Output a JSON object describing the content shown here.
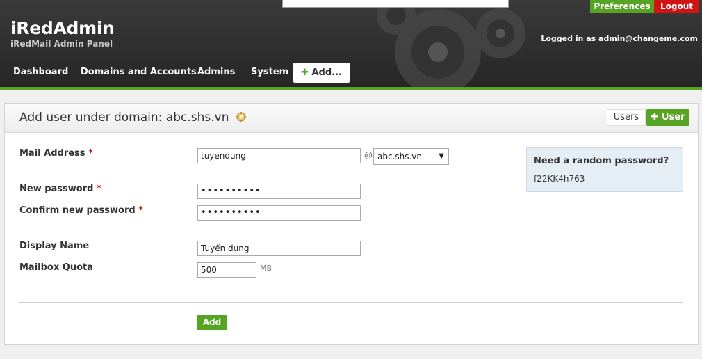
{
  "header": {
    "brand": "iRedAdmin",
    "tagline": "iRedMail Admin Panel",
    "preferences_label": "Preferences",
    "logout_label": "Logout",
    "logged_in_text": "Logged in as admin@changeme.com"
  },
  "nav": {
    "items": [
      "Dashboard",
      "Domains and Accounts",
      "Admins",
      "System"
    ],
    "add_label": "Add..."
  },
  "panel": {
    "title": "Add user under domain: abc.shs.vn",
    "tab_users": "Users",
    "tab_user": "User"
  },
  "form": {
    "mail_address_label": "Mail Address",
    "mail_address_value": "tuyendung",
    "at_sign": "@",
    "domain_selected": "abc.shs.vn",
    "new_password_label": "New password",
    "new_password_value": "••••••••••",
    "confirm_password_label": "Confirm new password",
    "confirm_password_value": "••••••••••",
    "display_name_label": "Display Name",
    "display_name_value": "Tuyển dụng",
    "quota_label": "Mailbox Quota",
    "quota_value": "500",
    "quota_unit": "MB",
    "required_mark": "*",
    "submit_label": "Add"
  },
  "random_password": {
    "title": "Need a random password?",
    "value": "f22KK4h763"
  },
  "colors": {
    "accent_green": "#57a424",
    "logout_red": "#d01414"
  }
}
